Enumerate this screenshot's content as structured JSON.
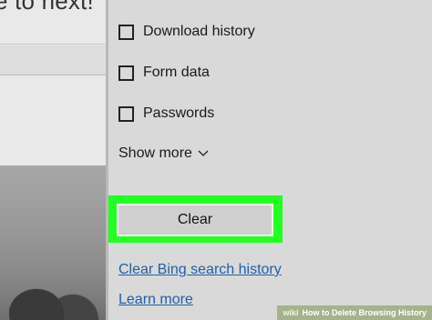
{
  "background": {
    "headline_fragment": "e to next!"
  },
  "options": [
    {
      "label": "Download history",
      "checked": false
    },
    {
      "label": "Form data",
      "checked": false
    },
    {
      "label": "Passwords",
      "checked": false
    }
  ],
  "show_more": {
    "label": "Show more",
    "icon": "chevron-down-icon"
  },
  "clear_button": {
    "label": "Clear"
  },
  "links": {
    "clear_bing": "Clear Bing search history",
    "learn_more": "Learn more"
  },
  "watermark": {
    "brand": "wiki",
    "title": "How to Delete Browsing History"
  },
  "colors": {
    "highlight": "#22ff22",
    "link": "#1f5fa8",
    "panel_bg": "#d9d9d9"
  }
}
